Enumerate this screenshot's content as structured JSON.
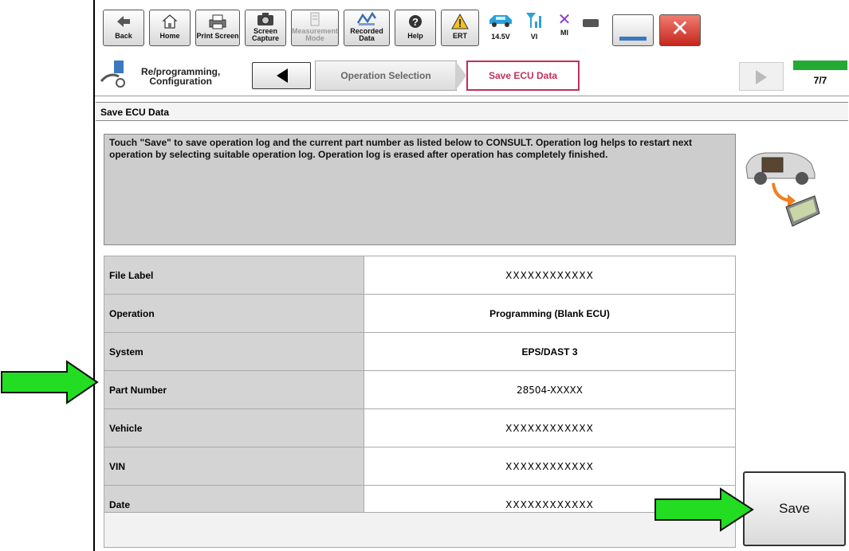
{
  "toolbar": {
    "back": "Back",
    "home": "Home",
    "print_screen": "Print Screen",
    "screen_capture_1": "Screen",
    "screen_capture_2": "Capture",
    "measurement_1": "Measurement",
    "measurement_2": "Mode",
    "recorded_1": "Recorded",
    "recorded_2": "Data",
    "help": "Help",
    "ert": "ERT",
    "voltage": "14.5V",
    "vi": "VI",
    "mi": "MI"
  },
  "nav": {
    "breadcrumb_1": "Re/programming,",
    "breadcrumb_2": "Configuration",
    "step_prev": "Operation Selection",
    "step_current": "Save ECU Data",
    "page_counter": "7/7"
  },
  "section_title": "Save ECU Data",
  "message": "Touch \"Save\" to save operation log and the current part number as listed below to CONSULT. Operation log helps to restart next operation by selecting suitable operation log. Operation log is erased after operation has completely finished.",
  "table": {
    "rows": [
      {
        "label": "File Label",
        "value": "XXXXXXXXXXXX"
      },
      {
        "label": "Operation",
        "value": "Programming (Blank ECU)"
      },
      {
        "label": "System",
        "value": "EPS/DAST 3"
      },
      {
        "label": "Part Number",
        "value": "28504-XXXXX"
      },
      {
        "label": "Vehicle",
        "value": "XXXXXXXXXXXX"
      },
      {
        "label": "VIN",
        "value": "XXXXXXXXXXXX"
      },
      {
        "label": "Date",
        "value": "XXXXXXXXXXXX"
      }
    ]
  },
  "save_button": "Save",
  "colors": {
    "arrow": "#22dd22",
    "current_step_border": "#c0305a",
    "close_red": "#d9342b",
    "progress_green": "#22aa33"
  }
}
